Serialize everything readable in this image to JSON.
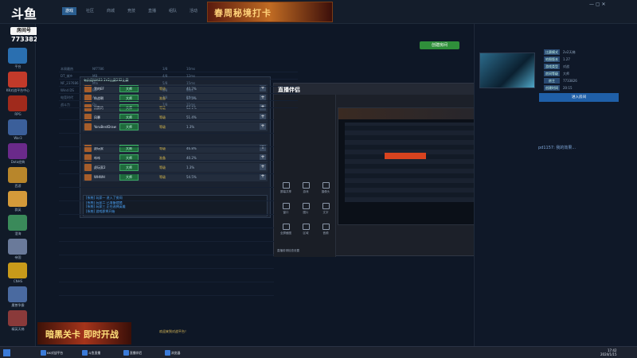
{
  "overlay": {
    "logo": "斗鱼",
    "sub_label": "房间号",
    "room_id": "7733826"
  },
  "topbar": {
    "tabs": [
      "游戏",
      "社区",
      "商城",
      "竞技",
      "直播",
      "组队",
      "活动"
    ],
    "active_tab": 0,
    "banner_text": "春周秘境打卡",
    "window_controls": "— ▢ ✕"
  },
  "sidebar": {
    "games": [
      {
        "label": "平台",
        "color": "#2a6fb0"
      },
      {
        "label": "KK对战平台中心",
        "color": "#c23a2a"
      },
      {
        "label": "RPG",
        "color": "#a02a1c"
      },
      {
        "label": "War3",
        "color": "#3b5f9a"
      },
      {
        "label": "Dota经典",
        "color": "#6a2a8a"
      },
      {
        "label": "西游",
        "color": "#b8862b"
      },
      {
        "label": "群英",
        "color": "#d49a3a"
      },
      {
        "label": "澄海",
        "color": "#3a8a5a"
      },
      {
        "label": "帝国",
        "color": "#6a7a9a"
      },
      {
        "label": "CNHS",
        "color": "#c89a1a"
      },
      {
        "label": "魔兽争霸",
        "color": "#4a6aa0"
      },
      {
        "label": "精英天梯",
        "color": "#8a3a3a"
      }
    ]
  },
  "lobby": {
    "create_label": "创建房间",
    "rows": [
      {
        "a": "本周最热",
        "b": "Nf7786",
        "c": "3/8",
        "d": "10ms"
      },
      {
        "a": "DT_城乡",
        "b": "MB",
        "c": "4/8",
        "d": "12ms"
      },
      {
        "a": "NF_237686",
        "b": "Mhi",
        "c": "5/8",
        "d": "15ms"
      },
      {
        "a": "Wind DS",
        "b": "Bn",
        "c": "6/8",
        "d": "9ms"
      },
      {
        "a": "电竞时代",
        "b": "Aq",
        "c": "2/8",
        "d": "20ms"
      },
      {
        "a": "战斗力",
        "b": "Qx",
        "c": "7/8",
        "d": "11ms"
      }
    ]
  },
  "room": {
    "title": "有阶段WAR3 2V2比赛2S2比赛",
    "team1": [
      {
        "name": "我的EF",
        "rank": "大师",
        "state": "等级",
        "pct": "40.2%"
      },
      {
        "name": "韩战朝",
        "rank": "大师",
        "state": "准备",
        "pct": "57.5%"
      },
      {
        "name": "沉默的",
        "rank": "大师",
        "state": "等级",
        "pct": "52.1%"
      },
      {
        "name": "风暴",
        "rank": "大师",
        "state": "等级",
        "pct": "51.4%"
      },
      {
        "name": "YoruBestDraw",
        "rank": "大师",
        "state": "等级",
        "pct": "1.3%"
      }
    ],
    "team2": [
      {
        "name": "虎玩家",
        "rank": "大师",
        "state": "等级",
        "pct": "46.8%"
      },
      {
        "name": "咔咔",
        "rank": "大师",
        "state": "准备",
        "pct": "40.2%"
      },
      {
        "name": "虎玩家2",
        "rank": "大师",
        "state": "等级",
        "pct": "1.3%"
      },
      {
        "name": "WHWH",
        "rank": "大师",
        "state": "等级",
        "pct": "54.5%"
      }
    ],
    "chat": [
      "[系统] 玩家一 进入了房间",
      "[系统] 玩家二 已准备就绪",
      "[系统] 玩家三 正在选择英雄",
      "[系统] 游戏即将开始"
    ]
  },
  "assist": {
    "logo": "直播伴侣",
    "tools": [
      "屏幕共享",
      "游戏",
      "摄像头",
      "窗口",
      "图片",
      "文字",
      "全屏截图",
      "区域",
      "音频"
    ],
    "go_live": "开始直播",
    "notice": "直播前请检查设置"
  },
  "right": {
    "info": [
      {
        "k": "比赛模式",
        "v": "2v2天梯"
      },
      {
        "k": "地图版本",
        "v": "1.27"
      },
      {
        "k": "游戏类型",
        "v": "对战"
      },
      {
        "k": "房间等级",
        "v": "大师"
      },
      {
        "k": "房主",
        "v": "7733826"
      },
      {
        "k": "创建时间",
        "v": "20:15"
      }
    ],
    "button": "进入房间",
    "chat": "pd1157: 我的效果..."
  },
  "promo": {
    "text": "暗黑关卡 即时开战"
  },
  "status_text": "欢迎来到对战平台！",
  "taskbar": {
    "apps": [
      "KK对战平台",
      "斗鱼直播",
      "直播伴侣",
      "浏览器"
    ],
    "time": "17:42",
    "date": "2024/1/15"
  }
}
